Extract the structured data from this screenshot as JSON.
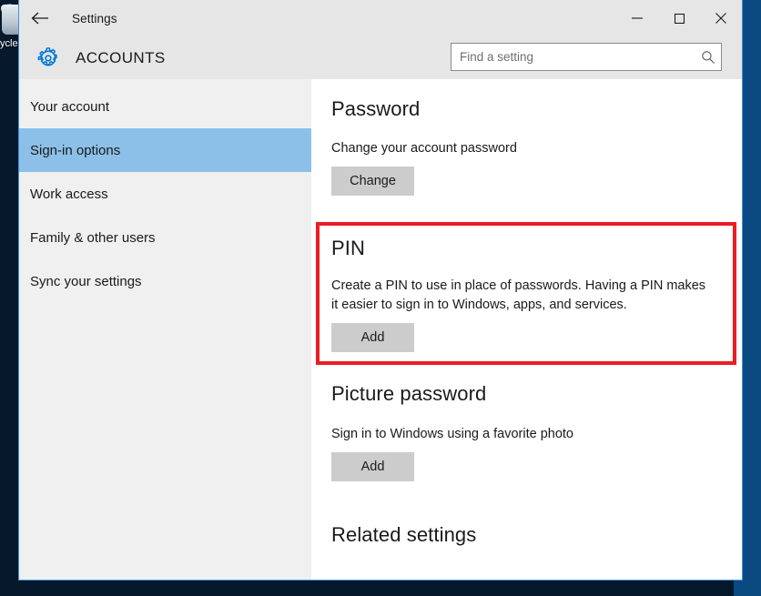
{
  "desktop": {
    "recycle_bin_label": "ycle",
    "recycle_bin_icon": "recycle-bin-icon"
  },
  "window": {
    "title": "Settings",
    "back_icon": "back-arrow-icon",
    "controls": {
      "minimize": "─",
      "maximize": "☐",
      "close": "✕",
      "minimize_name": "minimize-icon",
      "maximize_name": "maximize-icon",
      "close_name": "close-icon"
    }
  },
  "header": {
    "category": "ACCOUNTS",
    "gear_icon": "gear-icon"
  },
  "search": {
    "placeholder": "Find a setting",
    "value": "",
    "icon": "search-icon"
  },
  "sidebar": {
    "items": [
      {
        "label": "Your account",
        "selected": false
      },
      {
        "label": "Sign-in options",
        "selected": true
      },
      {
        "label": "Work access",
        "selected": false
      },
      {
        "label": "Family & other users",
        "selected": false
      },
      {
        "label": "Sync your settings",
        "selected": false
      }
    ]
  },
  "content": {
    "password": {
      "heading": "Password",
      "description": "Change your account password",
      "button": "Change"
    },
    "pin": {
      "heading": "PIN",
      "description": "Create a PIN to use in place of passwords. Having a PIN makes it easier to sign in to Windows, apps, and services.",
      "button": "Add"
    },
    "picture_password": {
      "heading": "Picture password",
      "description": "Sign in to Windows using a favorite photo",
      "button": "Add"
    },
    "related_settings": {
      "heading": "Related settings"
    }
  },
  "colors": {
    "accent_blue": "#0078d7",
    "selection_blue": "#8cc0e8",
    "annotation_red": "#ec1c24",
    "button_gray": "#cccccc",
    "header_gray": "#e6e6e6",
    "sidebar_gray": "#f0f0f0"
  }
}
